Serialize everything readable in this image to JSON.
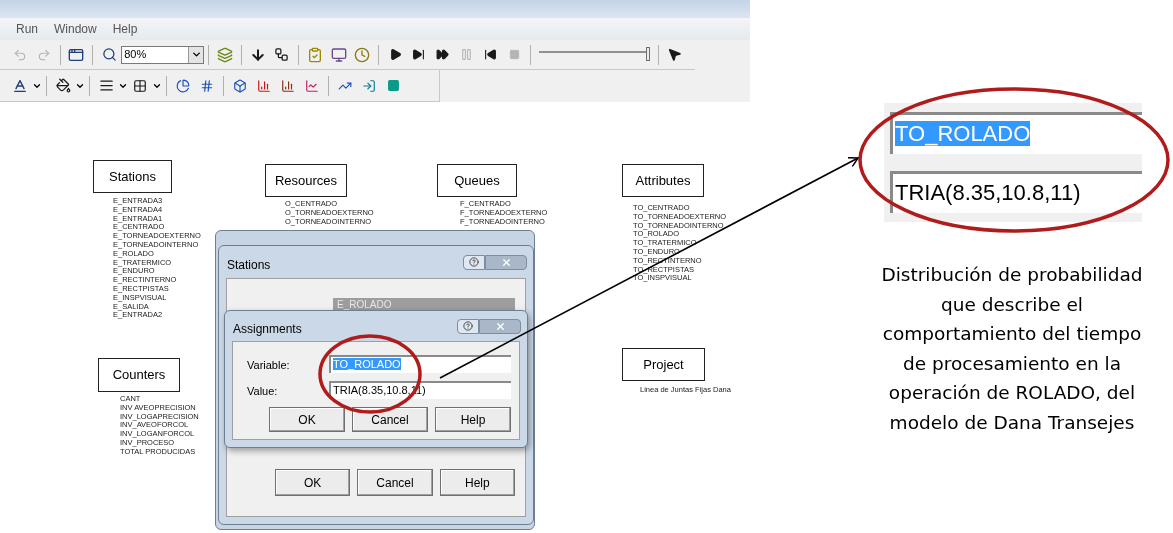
{
  "menu": [
    "Run",
    "Window",
    "Help"
  ],
  "toolbar": {
    "zoom": "80%",
    "speed_slider": {
      "level": 1
    }
  },
  "canvas": {
    "blocks": [
      {
        "title": "Stations",
        "items": [
          "E_ENTRADA3",
          "E_ENTRADA4",
          "E_ENTRADA1",
          "E_CENTRADO",
          "E_TORNEADOEXTERNO",
          "E_TORNEADOINTERNO",
          "E_ROLADO",
          "E_TRATERMICO",
          "E_ENDURO",
          "E_RECTINTERNO",
          "E_RECTPISTAS",
          "E_INSPVISUAL",
          "E_SALIDA",
          "E_ENTRADA2"
        ]
      },
      {
        "title": "Resources",
        "items": [
          "O_CENTRADO",
          "O_TORNEADOEXTERNO",
          "O_TORNEADOINTERNO"
        ]
      },
      {
        "title": "Queues",
        "items": [
          "F_CENTRADO",
          "F_TORNEADOEXTERNO",
          "F_TORNEADOINTERNO"
        ]
      },
      {
        "title": "Attributes",
        "items": [
          "TO_CENTRADO",
          "TO_TORNEADOEXTERNO",
          "TO_TORNEADOINTERNO",
          "TO_ROLADO",
          "TO_TRATERMICO",
          "TO_ENDURO",
          "TO_RECTINTERNO",
          "TO_RECTPISTAS",
          "TO_INSPVISUAL"
        ]
      },
      {
        "title": "Counters",
        "items": [
          "CANT",
          "INV AVEOPRECISION",
          "INV_LOGAPRECISION",
          "INV_AVEOFORCOL",
          "INV_LOGANFORCOL",
          "INV_PROCESO",
          "TOTAL PRODUCIDAS"
        ]
      },
      {
        "title": "Project",
        "items": [
          "Linea de Juntas Fijas Dana"
        ]
      }
    ]
  },
  "stations_dialog": {
    "title": "Stations",
    "field": "E_ROLADO",
    "buttons": [
      "OK",
      "Cancel",
      "Help"
    ]
  },
  "assignments_dialog": {
    "title": "Assignments",
    "fields": [
      {
        "label": "Variable:",
        "value": "TO_ROLADO",
        "selected": true
      },
      {
        "label": "Value:",
        "value": "TRIA(8.35,10.8,11)",
        "selected": false
      }
    ],
    "buttons": [
      "OK",
      "Cancel",
      "Help"
    ]
  },
  "inset": {
    "fields": [
      {
        "value": "TO_ROLADO",
        "selected": true
      },
      {
        "value": "TRIA(8.35,10.8,11)",
        "selected": false
      }
    ]
  },
  "caption_lines": [
    "Distribución de probabilidad",
    "que describe el",
    "comportamiento del tiempo",
    "de procesamiento en la",
    "operación de ROLADO, del",
    "modelo de Dana Transejes"
  ]
}
